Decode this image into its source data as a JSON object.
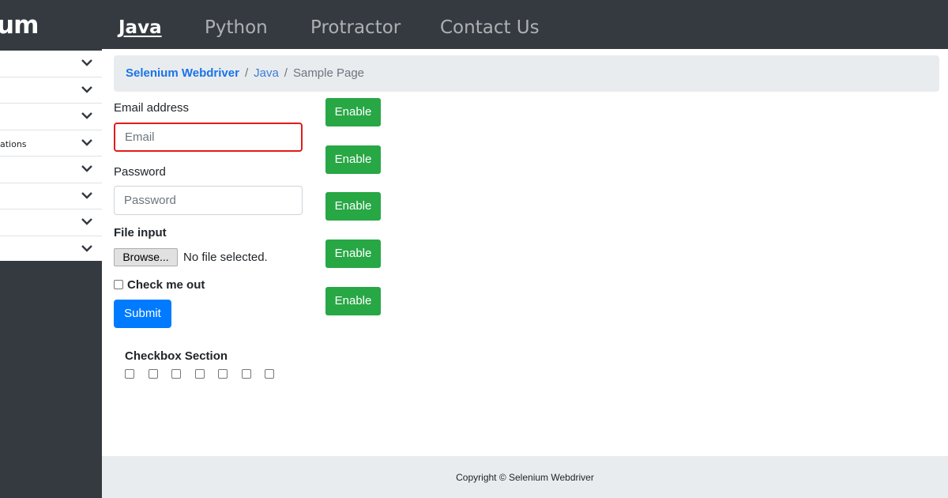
{
  "navbar": {
    "brand": "um",
    "links": [
      "Java",
      "Python",
      "Protractor",
      "Contact Us"
    ],
    "active": "Java"
  },
  "sidebar": {
    "items": [
      {
        "label": "",
        "icon": "chevron-down-icon"
      },
      {
        "label": "",
        "icon": "chevron-down-icon"
      },
      {
        "label": "",
        "icon": "chevron-down-icon"
      },
      {
        "label": "ations",
        "icon": "chevron-down-icon"
      },
      {
        "label": "",
        "icon": "chevron-down-icon"
      },
      {
        "label": "",
        "icon": "chevron-down-icon"
      },
      {
        "label": "",
        "icon": "chevron-down-icon"
      },
      {
        "label": "",
        "icon": "chevron-down-icon"
      }
    ]
  },
  "breadcrumb": {
    "items": [
      "Selenium Webdriver",
      "Java",
      "Sample Page"
    ],
    "separator": "/"
  },
  "form": {
    "email_label": "Email address",
    "email_placeholder": "Email",
    "email_value": "",
    "password_label": "Password",
    "password_placeholder": "Password",
    "password_value": "",
    "file_label": "File input",
    "browse_label": "Browse...",
    "file_status": "No file selected.",
    "check_label": "Check me out",
    "check_checked": false,
    "submit_label": "Submit"
  },
  "enable_buttons": [
    "Enable",
    "Enable",
    "Enable",
    "Enable",
    "Enable"
  ],
  "checkbox_section": {
    "title": "Checkbox Section",
    "checked": [
      false,
      false,
      false,
      false,
      false,
      false,
      false
    ]
  },
  "footer": {
    "text": "Copyright © Selenium Webdriver"
  },
  "colors": {
    "navbar_bg": "#343a40",
    "breadcrumb_bg": "#e9ecef",
    "primary": "#007bff",
    "success": "#28a745",
    "focus_border": "#e31b1b"
  }
}
